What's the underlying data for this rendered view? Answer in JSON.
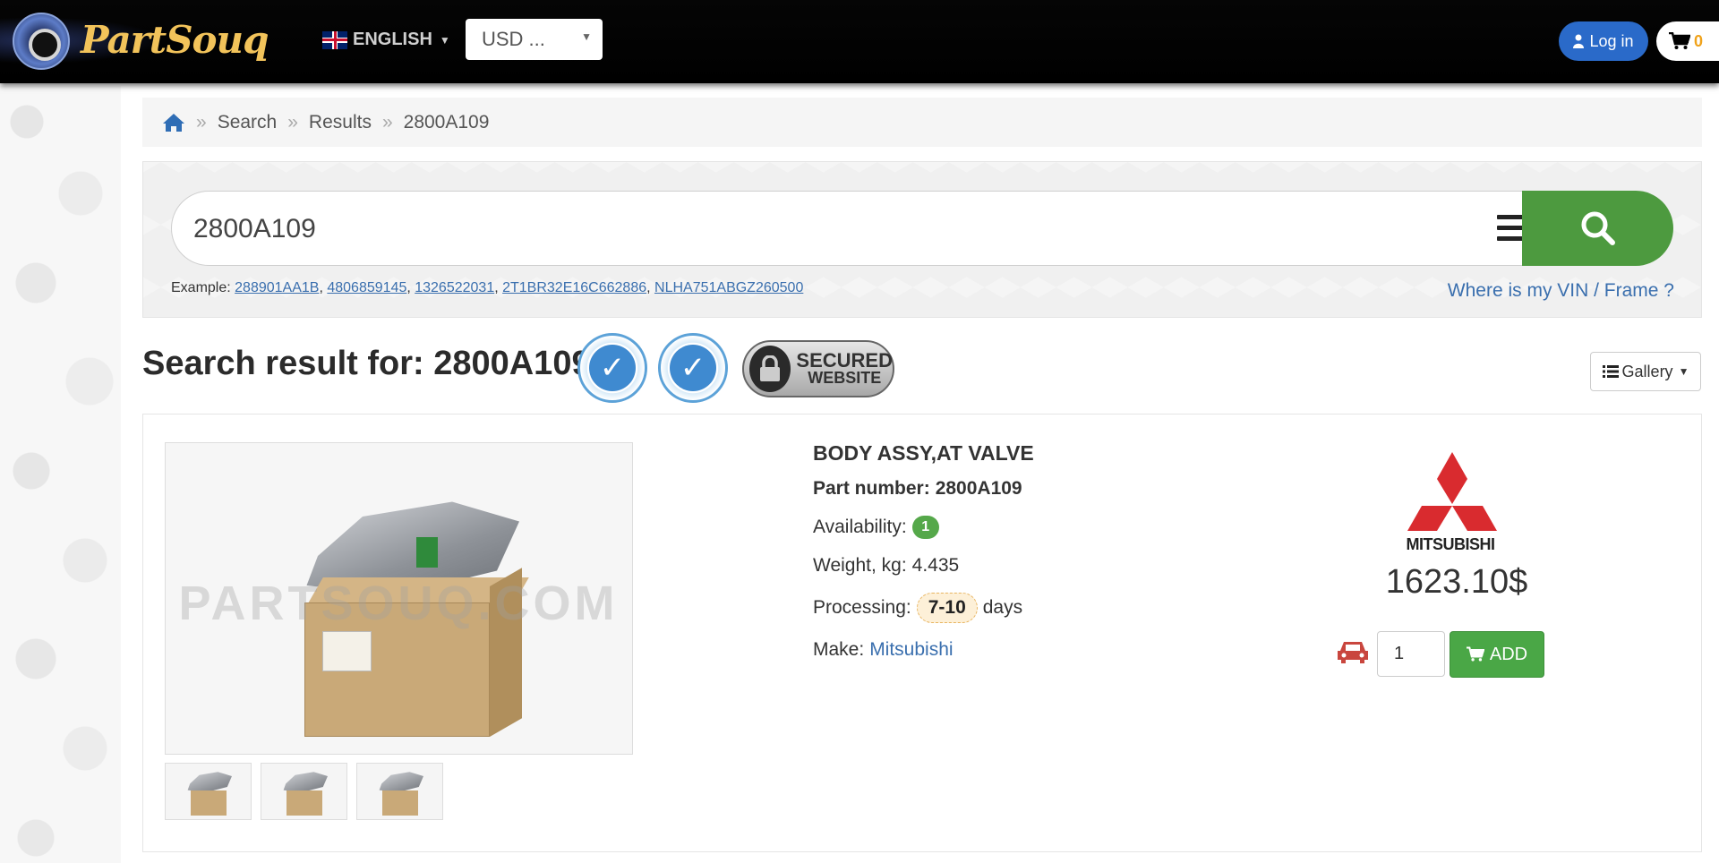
{
  "header": {
    "logo_text": "PartSouq",
    "language": "ENGLISH",
    "currency": "USD ...",
    "login_label": "Log in",
    "cart_count": "0"
  },
  "breadcrumb": {
    "items": [
      "Search",
      "Results",
      "2800A109"
    ],
    "separator": "»"
  },
  "search": {
    "value": "2800A109",
    "example_label": "Example:",
    "examples": [
      "288901AA1B",
      "4806859145",
      "1326522031",
      "2T1BR32E16C662886",
      "NLHA751ABGZ260500"
    ],
    "vin_link": "Where is my VIN / Frame ?"
  },
  "results": {
    "title": "Search result for: 2800A109",
    "badge_secured_line1": "SECURED",
    "badge_secured_line2": "WEBSITE",
    "view_label": "Gallery"
  },
  "product": {
    "name": "BODY ASSY,AT VALVE",
    "part_number_label": "Part number:",
    "part_number": "2800A109",
    "availability_label": "Availability:",
    "availability": "1",
    "weight_label": "Weight, kg:",
    "weight": "4.435",
    "processing_label": "Processing:",
    "processing": "7-10",
    "processing_unit": "days",
    "make_label": "Make:",
    "make": "Mitsubishi",
    "brand": "MITSUBISHI",
    "price": "1623.10$",
    "quantity": "1",
    "add_label": "ADD",
    "watermark": "PARTSOUQ.COM"
  },
  "colors": {
    "header_bg": "#000000",
    "accent_blue": "#2a6ac9",
    "search_green": "#4d9a3f",
    "add_green": "#4aa746",
    "link_blue": "#3a6fae",
    "brand_red": "#d92b2f"
  }
}
